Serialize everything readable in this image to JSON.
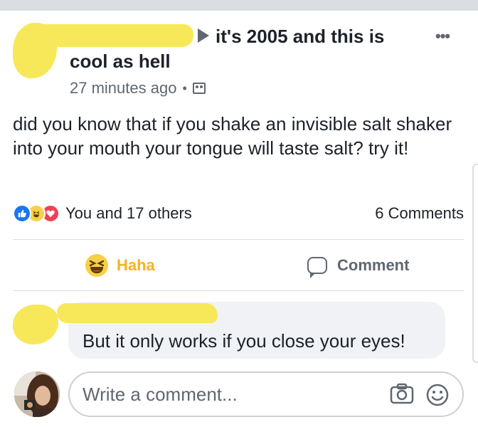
{
  "post": {
    "group_line1": "it's 2005 and this is",
    "group_line2": "cool as hell",
    "time": "27 minutes ago",
    "separator": "•",
    "body": "did you know that if you shake an invisible salt shaker into your mouth your tongue will taste salt? try it!",
    "reactions_label": "You and 17 others",
    "comments_count": "6 Comments",
    "icons": {
      "more": "more-options-icon",
      "audience": "group-audience-icon",
      "arrow": "triangle-right-icon"
    }
  },
  "actions": {
    "haha_label": "Haha",
    "comment_label": "Comment"
  },
  "comment": {
    "text": "But it only works if you close your eyes!"
  },
  "composer": {
    "placeholder": "Write a comment..."
  },
  "colors": {
    "like": "#1877f2",
    "haha": "#f7d046",
    "love": "#f33e58",
    "haha_text": "#f7b125",
    "redaction": "#f7e85a"
  }
}
